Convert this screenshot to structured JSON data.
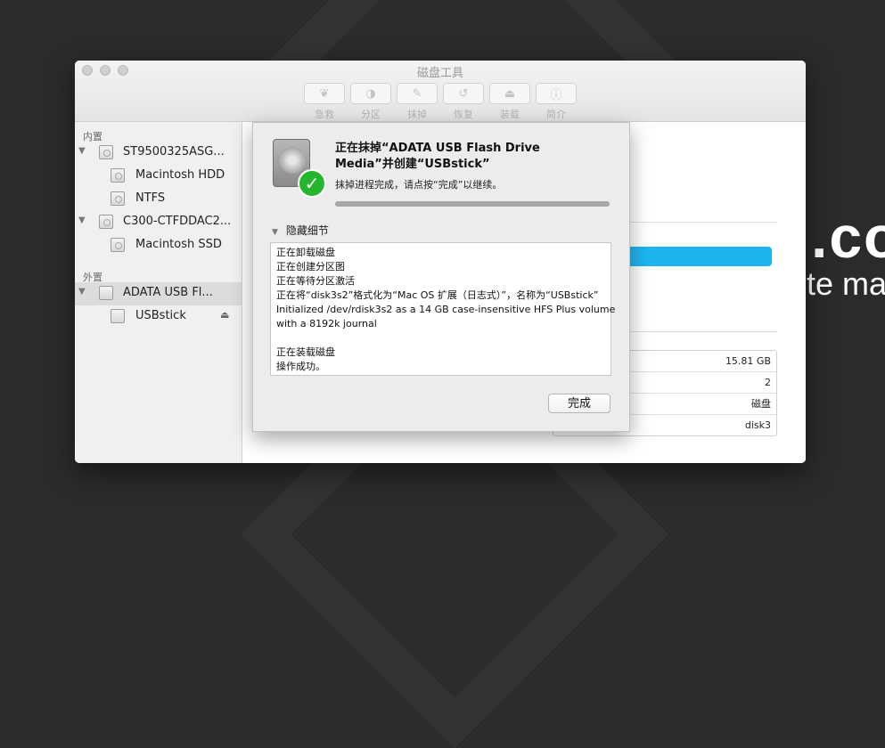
{
  "background": {
    "text_large": ".co",
    "text_small": "te ma"
  },
  "window": {
    "title": "磁盘工具"
  },
  "toolbar": {
    "items": [
      {
        "label": "急救",
        "icon": "stethoscope-icon",
        "glyph": "❦"
      },
      {
        "label": "分区",
        "icon": "partition-icon",
        "glyph": "◑"
      },
      {
        "label": "抹掉",
        "icon": "erase-icon",
        "glyph": "✎"
      },
      {
        "label": "恢复",
        "icon": "restore-icon",
        "glyph": "↺"
      },
      {
        "label": "装载",
        "icon": "mount-icon",
        "glyph": "⏏"
      },
      {
        "label": "简介",
        "icon": "info-icon",
        "glyph": "ⓘ"
      }
    ]
  },
  "sidebar": {
    "internal_title": "内置",
    "external_title": "外置",
    "items": [
      {
        "label": "ST9500325ASG...",
        "indent": 0,
        "expand": true
      },
      {
        "label": "Macintosh HDD",
        "indent": 1
      },
      {
        "label": "NTFS",
        "indent": 1
      },
      {
        "label": "C300-CTFDDAC2...",
        "indent": 0,
        "expand": true
      },
      {
        "label": "Macintosh SSD",
        "indent": 1
      },
      {
        "label": "ADATA USB Fl...",
        "indent": 0,
        "expand": true,
        "selected": true
      },
      {
        "label": "USBstick",
        "indent": 1,
        "eject": true
      }
    ]
  },
  "info_table": {
    "values": [
      "15.81 GB",
      "2",
      "磁盘",
      "disk3"
    ]
  },
  "sheet": {
    "title": "正在抹掉“ADATA USB Flash Drive Media”并创建“USBstick”",
    "subtitle": "抹掉进程完成，请点按“完成”以继续。",
    "progress": 1.0,
    "details_toggle": "隐藏细节",
    "log": [
      "正在卸载磁盘",
      "正在创建分区图",
      "正在等待分区激活",
      "正在将“disk3s2”格式化为“Mac OS 扩展（日志式）”，名称为“USBstick”",
      "Initialized /dev/rdisk3s2 as a 14 GB case-insensitive HFS Plus volume",
      "with a 8192k journal",
      "",
      "正在装载磁盘",
      "操作成功。"
    ],
    "done_label": "完成"
  }
}
